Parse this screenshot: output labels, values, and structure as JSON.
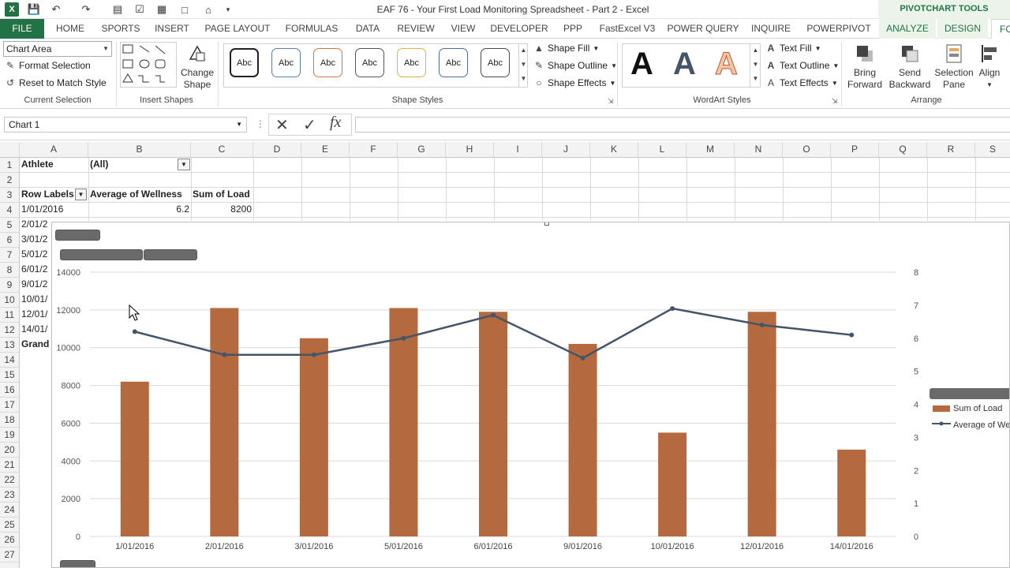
{
  "titlebar": {
    "title": "EAF 76 - Your First Load Monitoring Spreadsheet - Part 2 - Excel",
    "context_group": "PIVOTCHART TOOLS"
  },
  "tabs": [
    {
      "label": "FILE"
    },
    {
      "label": "HOME"
    },
    {
      "label": "SPORTS"
    },
    {
      "label": "INSERT"
    },
    {
      "label": "PAGE LAYOUT"
    },
    {
      "label": "FORMULAS"
    },
    {
      "label": "DATA"
    },
    {
      "label": "REVIEW"
    },
    {
      "label": "VIEW"
    },
    {
      "label": "DEVELOPER"
    },
    {
      "label": "PPP"
    },
    {
      "label": "FastExcel V3"
    },
    {
      "label": "POWER QUERY"
    },
    {
      "label": "INQUIRE"
    },
    {
      "label": "POWERPIVOT"
    },
    {
      "label": "ANALYZE"
    },
    {
      "label": "DESIGN"
    },
    {
      "label": "FO"
    }
  ],
  "ribbon": {
    "current_selection": {
      "dropdown_value": "Chart Area",
      "format_selection": "Format Selection",
      "reset": "Reset to Match Style",
      "group": "Current Selection"
    },
    "insert_shapes": {
      "change_shape": "Change Shape",
      "change_shape_l1": "Change",
      "change_shape_l2": "Shape",
      "group": "Insert Shapes"
    },
    "shape_styles": {
      "swatch_label": "Abc",
      "shape_fill": "Shape Fill",
      "shape_outline": "Shape Outline",
      "shape_effects": "Shape Effects",
      "group": "Shape Styles"
    },
    "wordart": {
      "letter": "A",
      "text_fill": "Text Fill",
      "text_outline": "Text Outline",
      "text_effects": "Text Effects",
      "group": "WordArt Styles"
    },
    "arrange": {
      "bring_forward_l1": "Bring",
      "bring_forward_l2": "Forward",
      "send_backward_l1": "Send",
      "send_backward_l2": "Backward",
      "selection_pane_l1": "Selection",
      "selection_pane_l2": "Pane",
      "align": "Align",
      "group": "Arrange"
    }
  },
  "formula_bar": {
    "name_box": "Chart 1",
    "formula": ""
  },
  "columns": [
    "A",
    "B",
    "C",
    "D",
    "E",
    "F",
    "G",
    "H",
    "I",
    "J",
    "K",
    "L",
    "M",
    "N",
    "O",
    "P",
    "Q",
    "R",
    "S"
  ],
  "rows": [
    "1",
    "2",
    "3",
    "4",
    "5",
    "6",
    "7",
    "8",
    "9",
    "10",
    "11",
    "12",
    "13",
    "14",
    "15",
    "16",
    "17",
    "18",
    "19",
    "20",
    "21",
    "22",
    "23",
    "24",
    "25",
    "26",
    "27"
  ],
  "pivot": {
    "filter_label": "Athlete",
    "filter_value": "(All)",
    "row_labels": "Row Labels",
    "col_b": "Average of Wellness",
    "col_c": "Sum of Load",
    "row4_label": "1/01/2016",
    "row4_b": "6.2",
    "row4_c": "8200",
    "partial_labels": [
      "2/01/2",
      "3/01/2",
      "5/01/2",
      "6/01/2",
      "9/01/2",
      "10/01/",
      "12/01/",
      "14/01/",
      "Grand"
    ]
  },
  "chart_data": {
    "type": "bar",
    "categories": [
      "1/01/2016",
      "2/01/2016",
      "3/01/2016",
      "5/01/2016",
      "6/01/2016",
      "9/01/2016",
      "10/01/2016",
      "12/01/2016",
      "14/01/2016"
    ],
    "series": [
      {
        "name": "Sum of Load",
        "type": "bar",
        "axis": "left",
        "color": "#b5693f",
        "values": [
          8200,
          12100,
          10500,
          12100,
          11900,
          10200,
          5500,
          11900,
          4600
        ]
      },
      {
        "name": "Average of Wellness",
        "type": "line",
        "axis": "right",
        "color": "#44546a",
        "values": [
          6.2,
          5.5,
          5.5,
          6.0,
          6.7,
          5.4,
          6.9,
          6.4,
          6.1
        ]
      }
    ],
    "y_left": {
      "min": 0,
      "max": 14000,
      "ticks": [
        "0",
        "2000",
        "4000",
        "6000",
        "8000",
        "10000",
        "12000",
        "14000"
      ]
    },
    "y_right": {
      "min": 0,
      "max": 8,
      "ticks": [
        "0",
        "1",
        "2",
        "3",
        "4",
        "5",
        "6",
        "7",
        "8"
      ]
    },
    "grid": true,
    "legend": {
      "position": "right",
      "entries": [
        "Sum of Load",
        "Average of Wellness"
      ]
    }
  }
}
